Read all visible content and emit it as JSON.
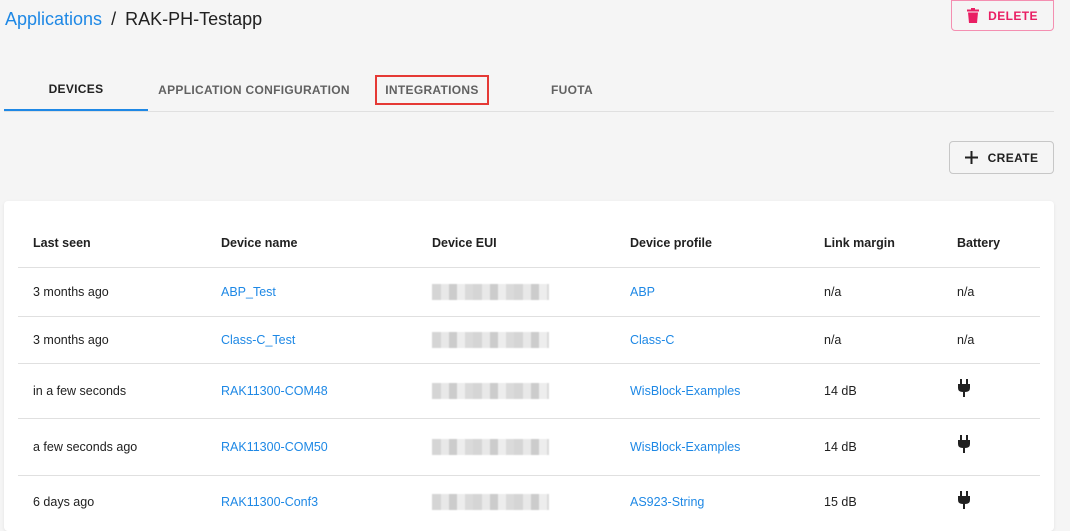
{
  "breadcrumb": {
    "parent": "Applications",
    "separator": "/",
    "current": "RAK-PH-Testapp"
  },
  "actions": {
    "delete_label": "DELETE",
    "create_label": "CREATE"
  },
  "tabs": [
    {
      "label": "DEVICES",
      "active": true
    },
    {
      "label": "APPLICATION CONFIGURATION",
      "active": false
    },
    {
      "label": "INTEGRATIONS",
      "active": false,
      "highlighted": true
    },
    {
      "label": "FUOTA",
      "active": false
    }
  ],
  "table": {
    "headers": [
      "Last seen",
      "Device name",
      "Device EUI",
      "Device profile",
      "Link margin",
      "Battery"
    ],
    "rows": [
      {
        "last_seen": "3 months ago",
        "name": "ABP_Test",
        "eui": "",
        "profile": "ABP",
        "link_margin": "n/a",
        "battery": "n/a"
      },
      {
        "last_seen": "3 months ago",
        "name": "Class-C_Test",
        "eui": "",
        "profile": "Class-C",
        "link_margin": "n/a",
        "battery": "n/a"
      },
      {
        "last_seen": "in a few seconds",
        "name": "RAK11300-COM48",
        "eui": "",
        "profile": "WisBlock-Examples",
        "link_margin": "14 dB",
        "battery": "plug-icon"
      },
      {
        "last_seen": "a few seconds ago",
        "name": "RAK11300-COM50",
        "eui": "",
        "profile": "WisBlock-Examples",
        "link_margin": "14 dB",
        "battery": "plug-icon"
      },
      {
        "last_seen": "6 days ago",
        "name": "RAK11300-Conf3",
        "eui": "",
        "profile": "AS923-String",
        "link_margin": "15 dB",
        "battery": "plug-icon"
      }
    ]
  },
  "colors": {
    "link": "#1e88e5",
    "delete": "#e91e63",
    "highlight_box": "#e53935"
  }
}
